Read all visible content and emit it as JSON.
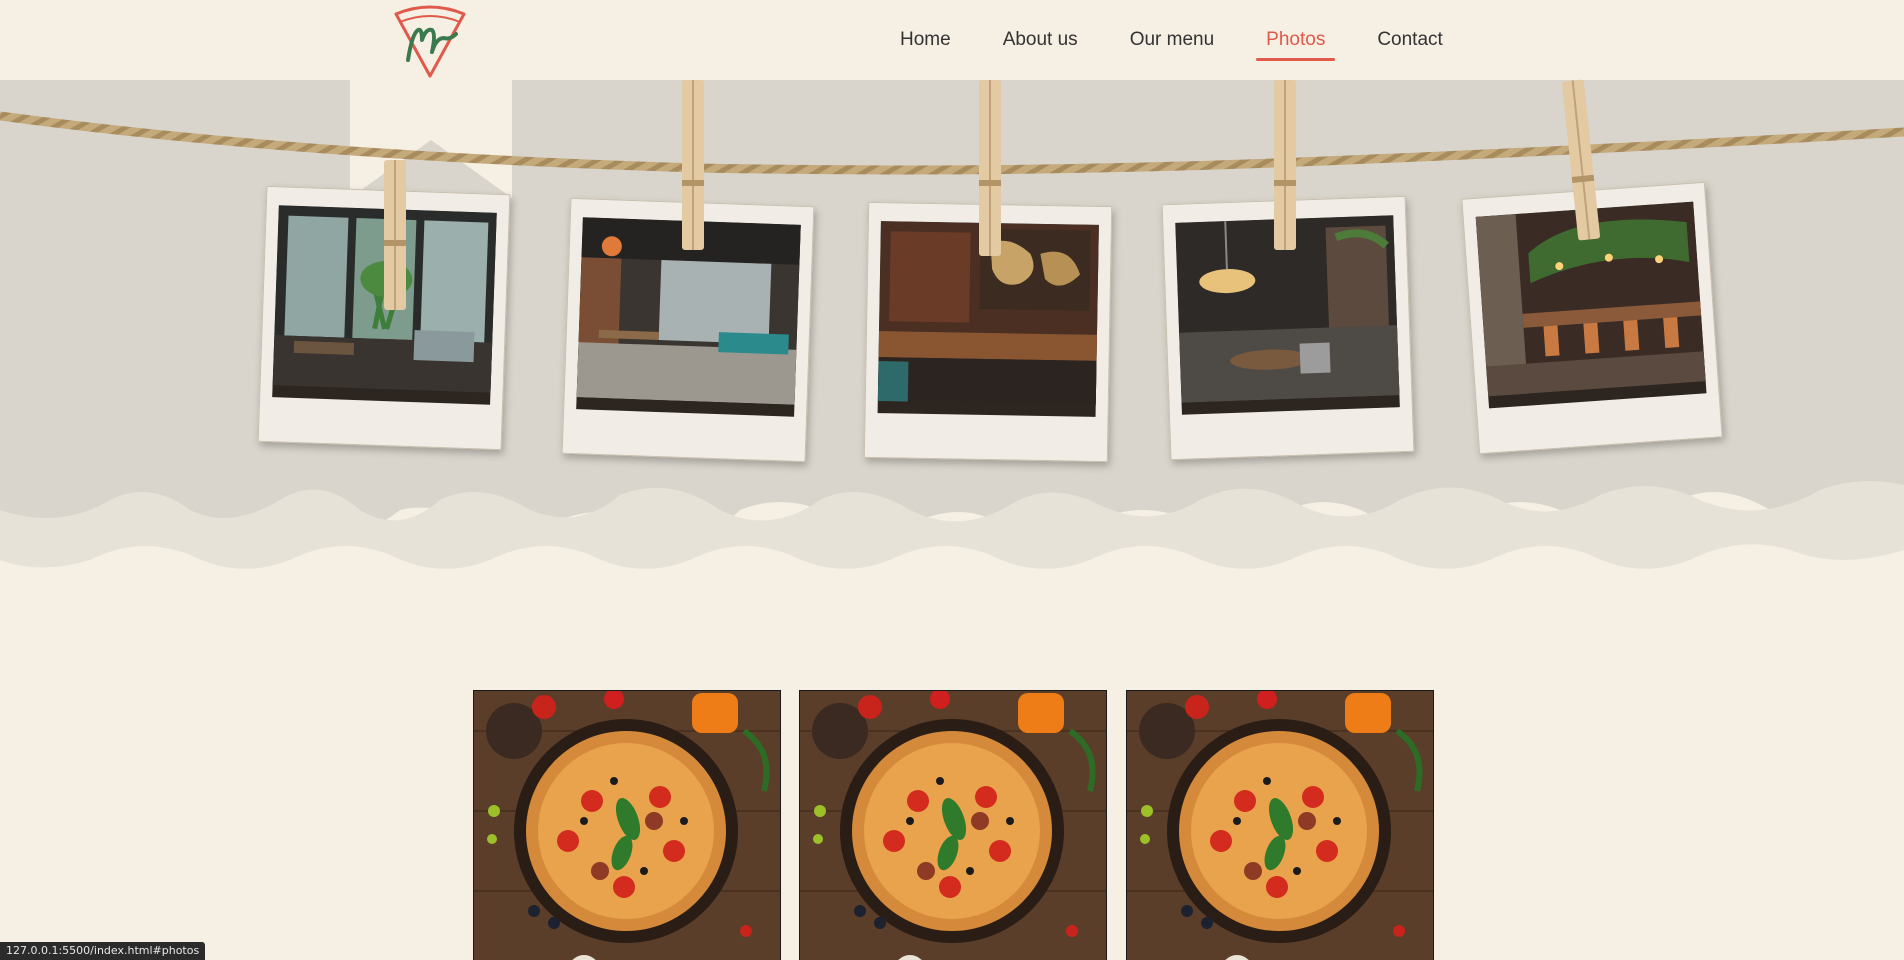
{
  "nav": {
    "items": [
      {
        "label": "Home",
        "active": false
      },
      {
        "label": "About us",
        "active": false
      },
      {
        "label": "Our menu",
        "active": false
      },
      {
        "label": "Photos",
        "active": true
      },
      {
        "label": "Contact",
        "active": false
      }
    ]
  },
  "logo": {
    "icon": "pizza-slice-logo-icon"
  },
  "gallery": {
    "photos": [
      {
        "name": "restaurant-photo-window-seating"
      },
      {
        "name": "restaurant-photo-dining-hall"
      },
      {
        "name": "restaurant-photo-wall-map"
      },
      {
        "name": "restaurant-photo-pendant-lights"
      },
      {
        "name": "restaurant-photo-bar-counter"
      }
    ]
  },
  "menu_photos": [
    {
      "name": "pizza-photo"
    },
    {
      "name": "pizza-photo"
    },
    {
      "name": "pizza-photo"
    }
  ],
  "status_bar": {
    "url": "127.0.0.1:5500/index.html#photos"
  },
  "colors": {
    "background": "#f5efe4",
    "band": "#d9d5cc",
    "accent": "#e0594a",
    "logo_green": "#3b7a4e"
  }
}
